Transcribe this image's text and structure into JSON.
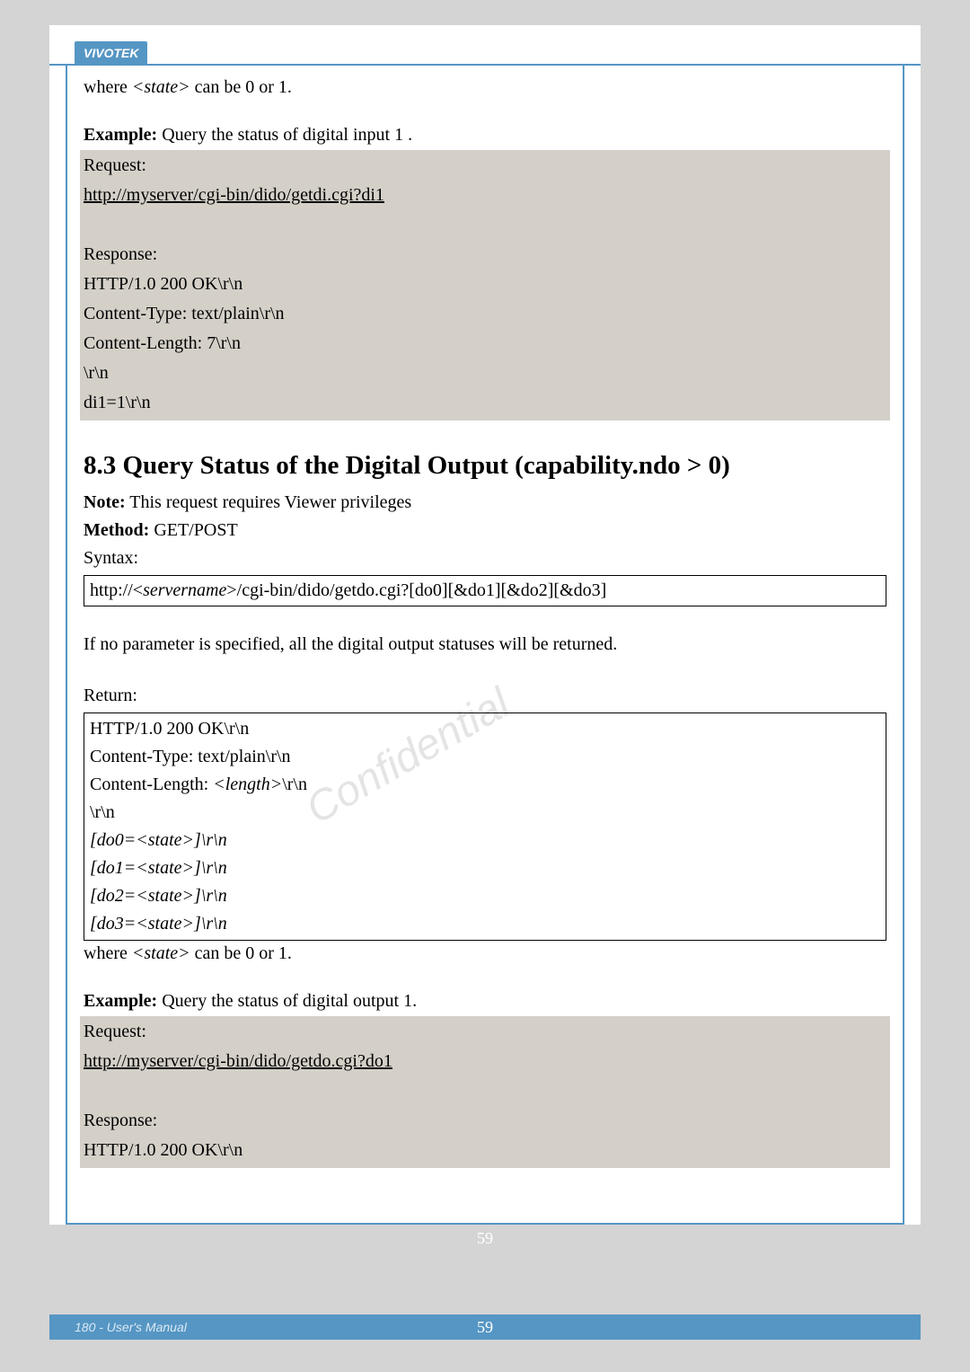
{
  "brand": "VIVOTEK",
  "intro": {
    "where_prefix": "where ",
    "state_tag": "<state>",
    "where_suffix": " can be 0 or 1.",
    "example_label": "Example:",
    "example_text": " Query the status of digital input 1 .",
    "request_label": "Request:",
    "request_url": "http://myserver/cgi-bin/dido/getdi.cgi?di1",
    "response_label": "Response:",
    "resp_l1": "HTTP/1.0 200 OK\\r\\n",
    "resp_l2": "Content-Type: text/plain\\r\\n",
    "resp_l3": "Content-Length: 7\\r\\n",
    "resp_l4": "\\r\\n",
    "resp_l5": "di1=1\\r\\n"
  },
  "section": {
    "heading": "8.3 Query Status of the Digital Output (capability.ndo > 0)",
    "note_label": "Note:",
    "note_text": " This request requires Viewer privileges",
    "method_label": "Method:",
    "method_text": " GET/POST",
    "syntax_label": "Syntax:",
    "syntax_pre": "http://<",
    "syntax_server": "servername",
    "syntax_post": ">/cgi-bin/dido/getdo.cgi?[do0][&do1][&do2][&do3]",
    "noparam": "If no parameter is specified, all the digital output statuses will be returned.",
    "return_label": "Return:",
    "ret_l1": "HTTP/1.0 200 OK\\r\\n",
    "ret_l2": "Content-Type: text/plain\\r\\n",
    "ret_l3a": "Content-Length: ",
    "ret_l3_len": "<length>",
    "ret_l3b": "\\r\\n",
    "ret_l4": "\\r\\n",
    "ret_do0a": "[do0=",
    "ret_state": "<state>",
    "ret_do0b": "]\\r\\n",
    "ret_do1a": "[do1=",
    "ret_do1b": "]\\r\\n",
    "ret_do2a": "[do2=",
    "ret_do2b": "]\\r\\n",
    "ret_do3a": "[do3=",
    "ret_do3b": "]\\r\\n",
    "where_prefix": "where ",
    "where_state": "<state>",
    "where_suffix": " can be 0 or 1.",
    "example_label": "Example:",
    "example_text": " Query the status of digital output 1.",
    "request_label": "Request:",
    "request_url": "http://myserver/cgi-bin/dido/getdo.cgi?do1",
    "response_label": "Response:",
    "resp2_l1": "HTTP/1.0 200 OK\\r\\n"
  },
  "footer": {
    "left": "180 - User's Manual",
    "center": "59"
  }
}
